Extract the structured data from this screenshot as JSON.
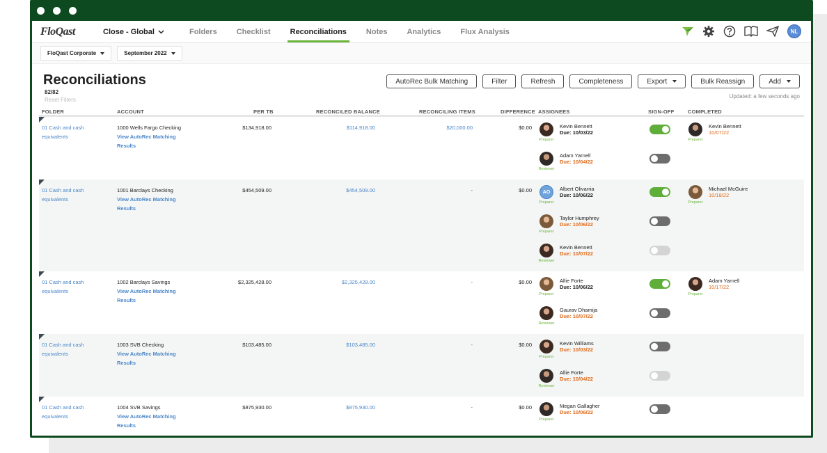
{
  "app": {
    "logo": "FloQast",
    "close_selector": "Close - Global",
    "nav_tabs": [
      "Folders",
      "Checklist",
      "Reconciliations",
      "Notes",
      "Analytics",
      "Flux Analysis"
    ],
    "user_initials": "NL"
  },
  "filters": {
    "entity": "FloQast Corporate",
    "period": "September 2022"
  },
  "page": {
    "title": "Reconciliations",
    "count": "82/82",
    "reset_filters": "Reset Filters",
    "updated": "Updated: a few seconds ago",
    "buttons": {
      "autorec": "AutoRec Bulk Matching",
      "filter": "Filter",
      "refresh": "Refresh",
      "completeness": "Completeness",
      "export": "Export",
      "bulk_reassign": "Bulk Reassign",
      "add": "Add"
    }
  },
  "table": {
    "headers": {
      "folder": "FOLDER",
      "account": "ACCOUNT",
      "per_tb": "PER TB",
      "reconciled": "RECONCILED BALANCE",
      "items": "RECONCILING ITEMS",
      "difference": "DIFFERENCE",
      "assignees": "ASSIGNEES",
      "signoff": "SIGN-OFF",
      "completed": "COMPLETED"
    },
    "link_line1": "View AutoRec Matching",
    "link_line2": "Results",
    "rows": [
      {
        "folder_1": "01 Cash and cash",
        "folder_2": "equivalents",
        "account": "1000 Wells Fargo Checking",
        "per_tb": "$134,918.00",
        "reconciled": "$114,918.00",
        "items": "$20,000.00",
        "difference": "$0.00",
        "assignees": [
          {
            "name": "Kevin Bennett",
            "due": "Due: 10/03/22",
            "role": "Preparer",
            "signed": "on",
            "late": false
          },
          {
            "name": "Adam Yarnell",
            "due": "Due: 10/04/22",
            "role": "Reviewer",
            "signed": "off",
            "late": true
          }
        ],
        "completed": {
          "name": "Kevin Bennett",
          "date": "10/07/22",
          "role": "Preparer"
        }
      },
      {
        "folder_1": "01 Cash and cash",
        "folder_2": "equivalents",
        "account": "1001 Barclays Checking",
        "per_tb": "$454,509.00",
        "reconciled": "$454,509.00",
        "items": "-",
        "difference": "$0.00",
        "assignees": [
          {
            "name": "Albert Olivarria",
            "due": "Due: 10/06/22",
            "role": "Preparer",
            "signed": "on",
            "late": false,
            "initials": "AO"
          },
          {
            "name": "Taylor Humphrey",
            "due": "Due: 10/06/22",
            "role": "Preparer",
            "signed": "off",
            "late": true
          },
          {
            "name": "Kevin Bennett",
            "due": "Due: 10/07/22",
            "role": "Reviewer",
            "signed": "dis",
            "late": true
          }
        ],
        "completed": {
          "name": "Michael McGuire",
          "date": "10/18/22",
          "role": "Preparer"
        }
      },
      {
        "folder_1": "01 Cash and cash",
        "folder_2": "equivalents",
        "account": "1002 Barclays Savings",
        "per_tb": "$2,325,428.00",
        "reconciled": "$2,325,428.00",
        "items": "-",
        "difference": "$0.00",
        "assignees": [
          {
            "name": "Allie Forte",
            "due": "Due: 10/06/22",
            "role": "Preparer",
            "signed": "on",
            "late": false
          },
          {
            "name": "Gaurav Dhamija",
            "due": "Due: 10/07/22",
            "role": "Reviewer",
            "signed": "off",
            "late": true
          }
        ],
        "completed": {
          "name": "Adam Yarnell",
          "date": "10/17/22",
          "role": "Preparer"
        }
      },
      {
        "folder_1": "01 Cash and cash",
        "folder_2": "equivalents",
        "account": "1003 SVB Checking",
        "per_tb": "$103,485.00",
        "reconciled": "$103,485.00",
        "items": "-",
        "difference": "$0.00",
        "assignees": [
          {
            "name": "Kevin Williams",
            "due": "Due: 10/03/22",
            "role": "Preparer",
            "signed": "off",
            "late": true
          },
          {
            "name": "Allie Forte",
            "due": "Due: 10/04/22",
            "role": "Reviewer",
            "signed": "dis",
            "late": true
          }
        ],
        "completed": null
      },
      {
        "folder_1": "01 Cash and cash",
        "folder_2": "equivalents",
        "account": "1004 SVB Savings",
        "per_tb": "$875,930.00",
        "reconciled": "$875,930.00",
        "items": "-",
        "difference": "$0.00",
        "assignees": [
          {
            "name": "Megan Gallagher",
            "due": "Due: 10/06/22",
            "role": "Preparer",
            "signed": "off",
            "late": true
          }
        ],
        "completed": null
      }
    ]
  },
  "colors": {
    "frame": "#0d4a1f",
    "accent": "#6ab43a",
    "link": "#4a86c8",
    "late": "#e06a1a"
  }
}
